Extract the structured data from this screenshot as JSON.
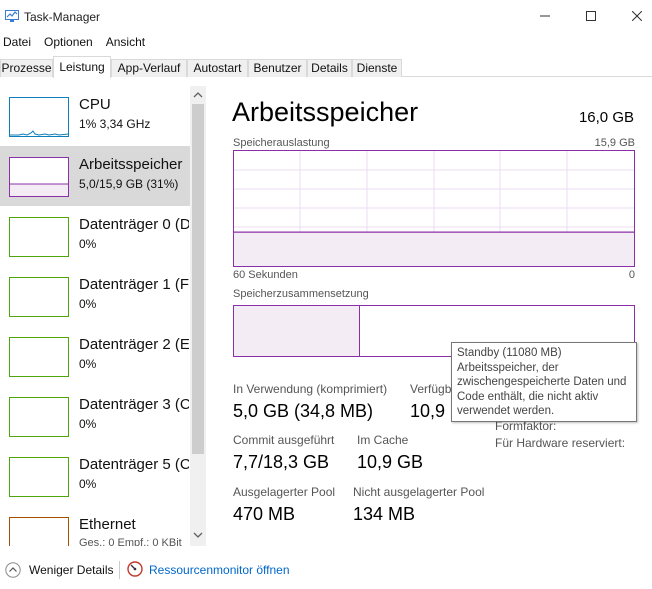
{
  "window": {
    "title": "Task-Manager"
  },
  "menu": [
    "Datei",
    "Optionen",
    "Ansicht"
  ],
  "tabs": [
    "Prozesse",
    "Leistung",
    "App-Verlauf",
    "Autostart",
    "Benutzer",
    "Details",
    "Dienste"
  ],
  "active_tab": "Leistung",
  "sidebar": {
    "items": [
      {
        "title": "CPU",
        "sub": "1% 3,34 GHz",
        "color": "#117dbb",
        "icon": "cpu-graph"
      },
      {
        "title": "Arbeitsspeicher",
        "sub": "5,0/15,9 GB (31%)",
        "color": "#8b2fa8",
        "icon": "memory-graph",
        "selected": true
      },
      {
        "title": "Datenträger 0 (D",
        "sub": "0%",
        "color": "#4da60c",
        "icon": "disk-graph"
      },
      {
        "title": "Datenträger 1 (F",
        "sub": "0%",
        "color": "#4da60c",
        "icon": "disk-graph"
      },
      {
        "title": "Datenträger 2 (E",
        "sub": "0%",
        "color": "#4da60c",
        "icon": "disk-graph"
      },
      {
        "title": "Datenträger 3 (C",
        "sub": "0%",
        "color": "#4da60c",
        "icon": "disk-graph"
      },
      {
        "title": "Datenträger 5 (C",
        "sub": "0%",
        "color": "#4da60c",
        "icon": "disk-graph"
      },
      {
        "title": "Ethernet",
        "sub": "Ges.: 0 Empf.: 0 KBit",
        "color": "#a74f01",
        "icon": "network-graph"
      }
    ]
  },
  "main": {
    "title": "Arbeitsspeicher",
    "total": "16,0 GB",
    "usage_label": "Speicherauslastung",
    "usage_max": "15,9 GB",
    "time_left": "60 Sekunden",
    "time_right": "0",
    "composition_label": "Speicherzusammensetzung",
    "memory_used_fraction": 0.31,
    "composition_used_fraction": 0.315
  },
  "stats": {
    "in_use_label": "In Verwendung (komprimiert)",
    "in_use_value": "5,0 GB (34,8 MB)",
    "available_label": "Verfügb",
    "available_value": "10,9",
    "commit_label": "Commit ausgeführt",
    "commit_value": "7,7/18,3 GB",
    "cache_label": "Im Cache",
    "cache_value": "10,9 GB",
    "paged_label": "Ausgelagerter Pool",
    "paged_value": "470 MB",
    "nonpaged_label": "Nicht ausgelagerter Pool",
    "nonpaged_value": "134 MB",
    "form_factor_label": "Formfaktor:",
    "hw_reserved_label": "Für Hardware reserviert:"
  },
  "tooltip": {
    "lines": [
      "Standby (11080 MB)",
      "Arbeitsspeicher, der",
      "zwischengespeicherte Daten und",
      "Code enthält, die nicht aktiv",
      "verwendet werden."
    ]
  },
  "footer": {
    "fewer_details": "Weniger Details",
    "resource_monitor": "Ressourcenmonitor öffnen"
  }
}
